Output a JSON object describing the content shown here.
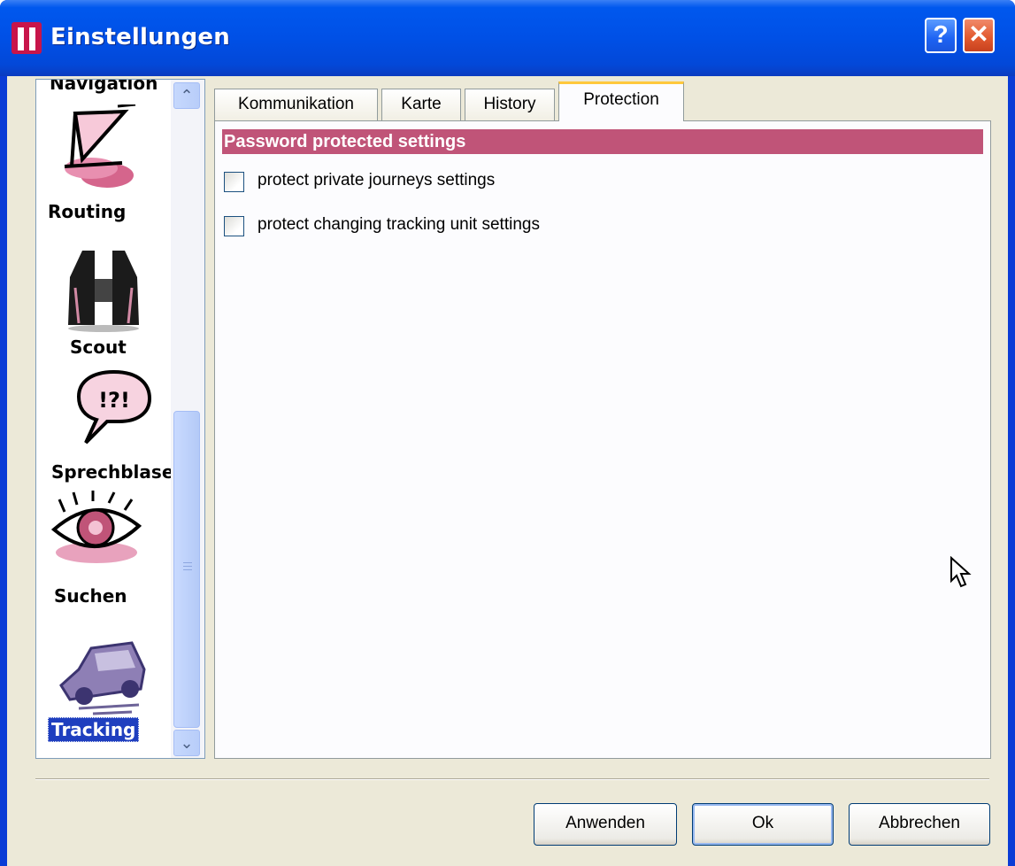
{
  "window": {
    "title": "Einstellungen",
    "help_label": "?",
    "close_label": "✕"
  },
  "nav": {
    "items": [
      {
        "label": "Navigation",
        "icon": "navigation-icon"
      },
      {
        "label": "Routing",
        "icon": "routing-icon"
      },
      {
        "label": "Scout",
        "icon": "binoculars-icon"
      },
      {
        "label": "Sprechblase",
        "icon": "speech-bubble-icon"
      },
      {
        "label": "Suchen",
        "icon": "eye-icon"
      },
      {
        "label": "Tracking",
        "icon": "car-icon",
        "selected": true
      }
    ],
    "bubble_text": "!?!"
  },
  "tabs": [
    {
      "label": "Kommunikation"
    },
    {
      "label": "Karte"
    },
    {
      "label": "History"
    },
    {
      "label": "Protection",
      "active": true
    }
  ],
  "protection": {
    "section_title": "Password protected settings",
    "options": [
      {
        "label": "protect private journeys settings",
        "checked": false
      },
      {
        "label": "protect changing tracking unit settings",
        "checked": false
      }
    ]
  },
  "buttons": {
    "apply": "Anwenden",
    "ok": "Ok",
    "cancel": "Abbrechen"
  },
  "colors": {
    "section_header": "#c05478",
    "title_bar": "#0050e6",
    "selection": "#1f3fbf",
    "active_tab_accent": "#ffc83c"
  }
}
